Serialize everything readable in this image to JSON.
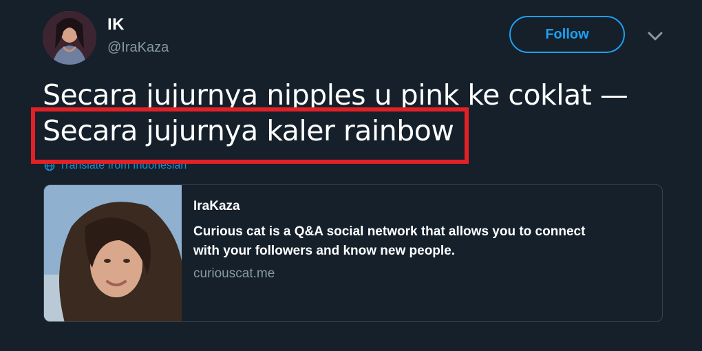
{
  "user": {
    "display_name": "IK",
    "handle": "@IraKaza"
  },
  "follow_button": {
    "label": "Follow"
  },
  "tweet": {
    "lines": [
      "Secara jujurnya nipples u pink ke coklat —",
      "Secara jujurnya kaler rainbow"
    ],
    "translate_label": "Translate from Indonesian"
  },
  "card": {
    "title": "IraKaza",
    "description_lines": [
      "Curious cat is a Q&A social network that allows you to connect",
      "with your followers and know new people."
    ],
    "domain": "curiouscat.me"
  },
  "colors": {
    "background": "#15202b",
    "accent": "#1da1f2",
    "highlight_box": "#e32026",
    "muted_text": "#8899a6",
    "card_border": "#38444d"
  },
  "icons": {
    "caret": "chevron-down-icon",
    "translate": "globe-icon"
  }
}
